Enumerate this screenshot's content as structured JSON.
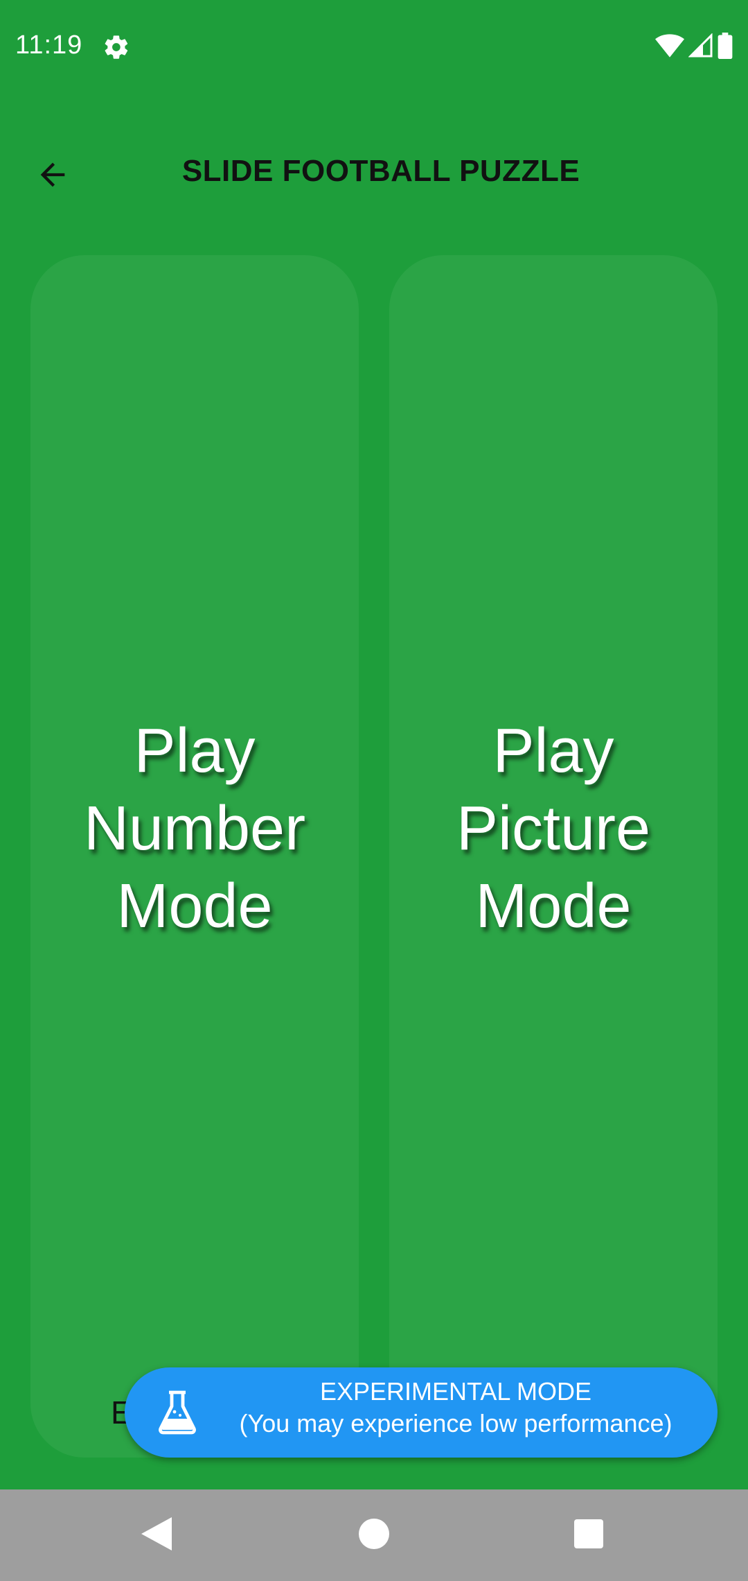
{
  "status_bar": {
    "time": "11:19",
    "icons": [
      "gear-icon",
      "wifi-icon",
      "cell-signal-icon",
      "battery-icon"
    ]
  },
  "app_bar": {
    "title": "SLIDE FOOTBALL PUZZLE",
    "back_icon": "arrow-left-icon"
  },
  "cards": {
    "number_mode": {
      "line1": "Play",
      "line2": "Number",
      "line3": "Mode"
    },
    "picture_mode": {
      "line1": "Play",
      "line2": "Picture",
      "line3": "Mode"
    }
  },
  "partially_hidden_text": "E",
  "banner": {
    "icon": "flask-icon",
    "line1": "EXPERIMENTAL MODE",
    "line2": "(You may experience low performance)"
  },
  "nav_bar": {
    "icons": [
      "nav-back-icon",
      "nav-home-icon",
      "nav-recents-icon"
    ]
  },
  "colors": {
    "background": "#1e9e3b",
    "card": "#2ba446",
    "banner": "#2196f3",
    "nav_bar": "#9e9e9e"
  }
}
